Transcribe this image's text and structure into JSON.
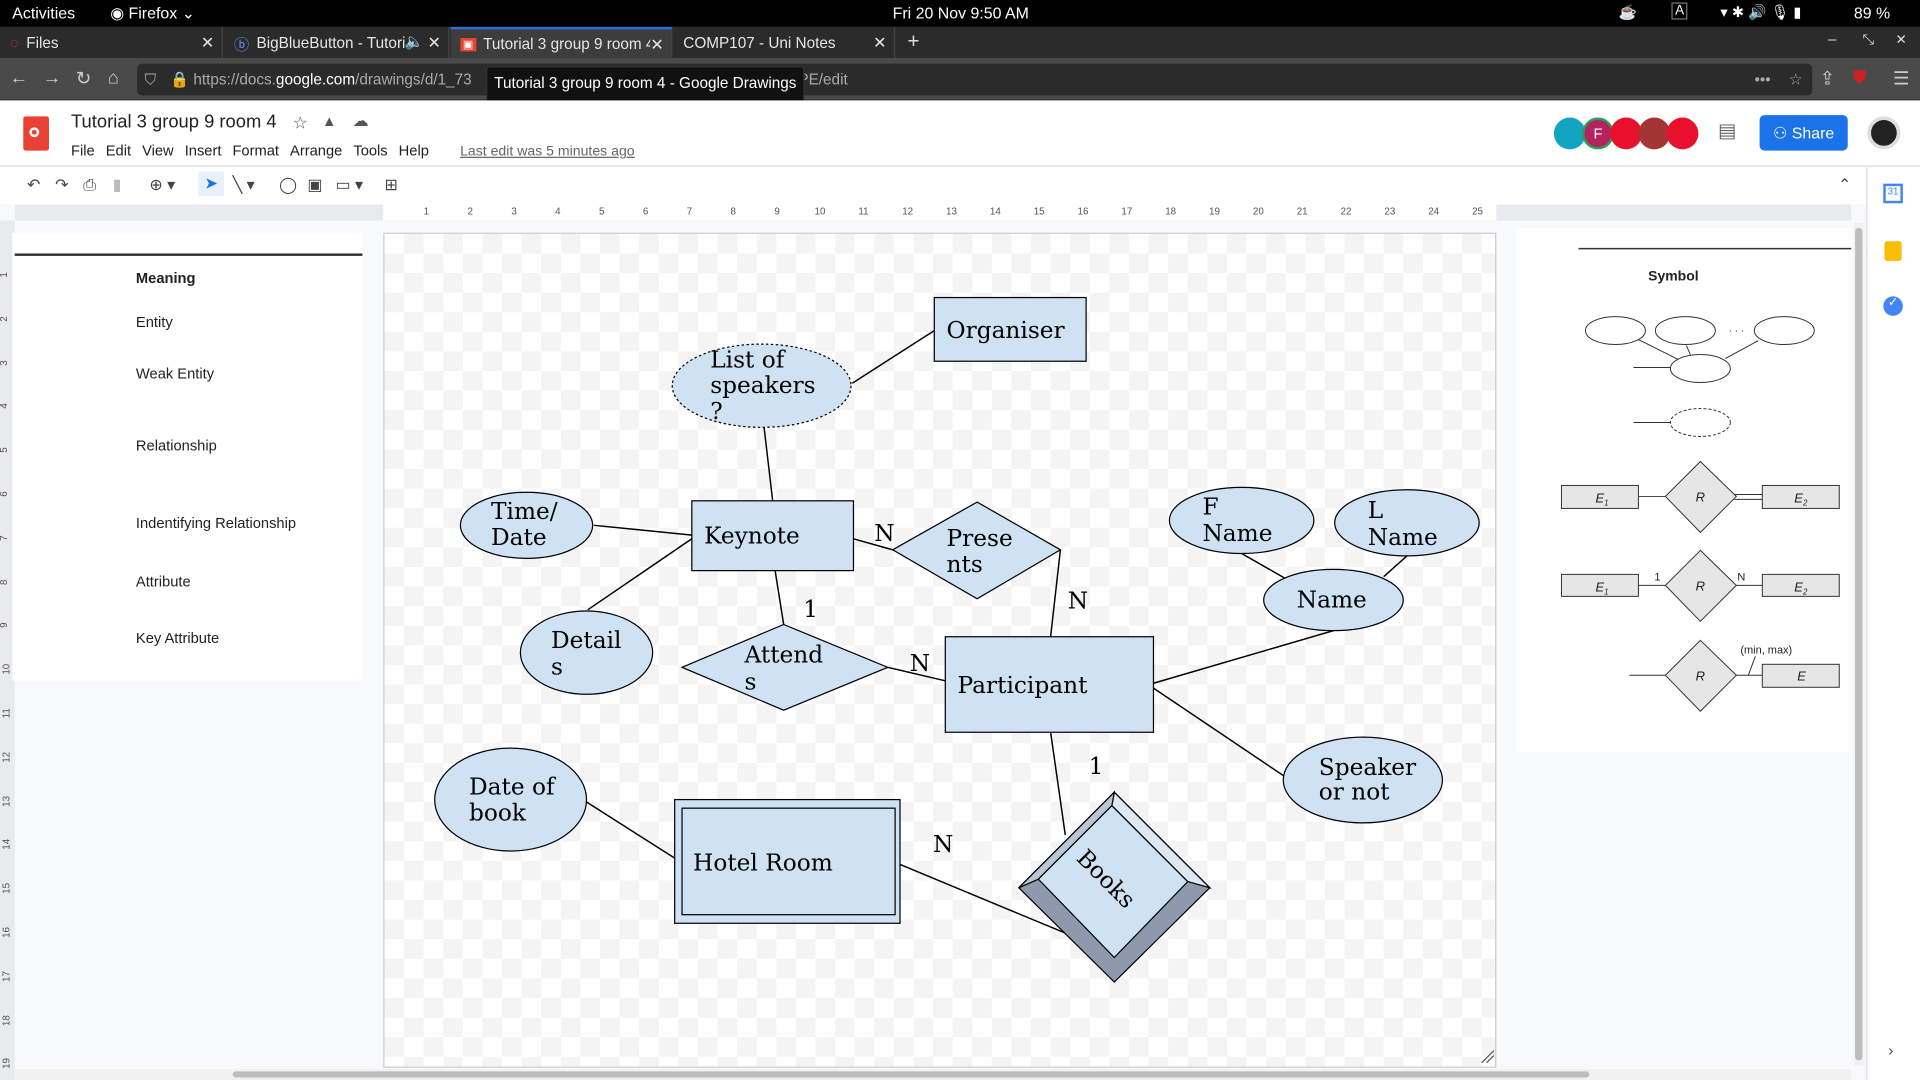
{
  "system": {
    "activities": "Activities",
    "app": "Firefox",
    "datetime": "Fri 20 Nov  9:50 AM",
    "battery": "89 %"
  },
  "tabs": [
    {
      "label": "Files"
    },
    {
      "label": "BigBlueButton - Tutori"
    },
    {
      "label": "Tutorial 3 group 9 room 4"
    },
    {
      "label": "COMP107 - Uni Notes"
    }
  ],
  "browser": {
    "url_prefix": "https://docs.",
    "url_domain": "google.com",
    "url_rest": "/drawings/d/1_73",
    "url_end": "PE/edit",
    "tooltip": "Tutorial 3 group 9 room 4 - Google Drawings"
  },
  "doc": {
    "title": "Tutorial 3 group 9 room 4",
    "menu": [
      "File",
      "Edit",
      "View",
      "Insert",
      "Format",
      "Arrange",
      "Tools",
      "Help"
    ],
    "last_edit": "Last edit was 5 minutes ago",
    "share": "Share",
    "collaborator_initial": "F"
  },
  "ruler": {
    "h": [
      "1",
      "2",
      "3",
      "4",
      "5",
      "6",
      "7",
      "8",
      "9",
      "10",
      "11",
      "12",
      "13",
      "14",
      "15",
      "16",
      "17",
      "18",
      "19",
      "20",
      "21",
      "22",
      "23",
      "24",
      "25"
    ],
    "v": [
      "1",
      "2",
      "3",
      "4",
      "5",
      "6",
      "7",
      "8",
      "9",
      "10",
      "11",
      "12",
      "13",
      "14",
      "15",
      "16",
      "17",
      "18",
      "19"
    ]
  },
  "legend_left": {
    "header": "Meaning",
    "items": [
      "Entity",
      "Weak Entity",
      "Relationship",
      "Indentifying Relationship",
      "Attribute",
      "Key Attribute"
    ]
  },
  "legend_right": {
    "header": "Symbol",
    "e1": "E",
    "e2": "E",
    "sub1": "1",
    "sub2": "2",
    "r": "R",
    "one": "1",
    "n": "N",
    "minmax": "(min, max)",
    "e": "E",
    "dots": "· · ·"
  },
  "diagram": {
    "organiser": "Organiser",
    "speakers": [
      "List of",
      "speakers",
      "?"
    ],
    "keynote": "Keynote",
    "timedate": [
      "Time/",
      "Date"
    ],
    "details": [
      "Detail",
      "s"
    ],
    "presents": [
      "Prese",
      "nts"
    ],
    "attends": [
      "Attend",
      "s"
    ],
    "participant": "Participant",
    "name": "Name",
    "fname": [
      "F",
      "Name"
    ],
    "lname": [
      "L",
      "Name"
    ],
    "speaker": [
      "Speaker",
      "or not"
    ],
    "dateofbook": [
      "Date of",
      "book"
    ],
    "hotel": "Hotel Room",
    "books": "Books",
    "card_keynote_presents": "N",
    "card_presents_participant": "N",
    "card_keynote_attends": "1",
    "card_attends_participant": "N",
    "card_participant_books": "1",
    "card_hotel_books": "N"
  },
  "colors": {
    "entity_fill": "#cfe2f3",
    "share": "#1a73e8",
    "active_tab": "#2a6fd6"
  }
}
